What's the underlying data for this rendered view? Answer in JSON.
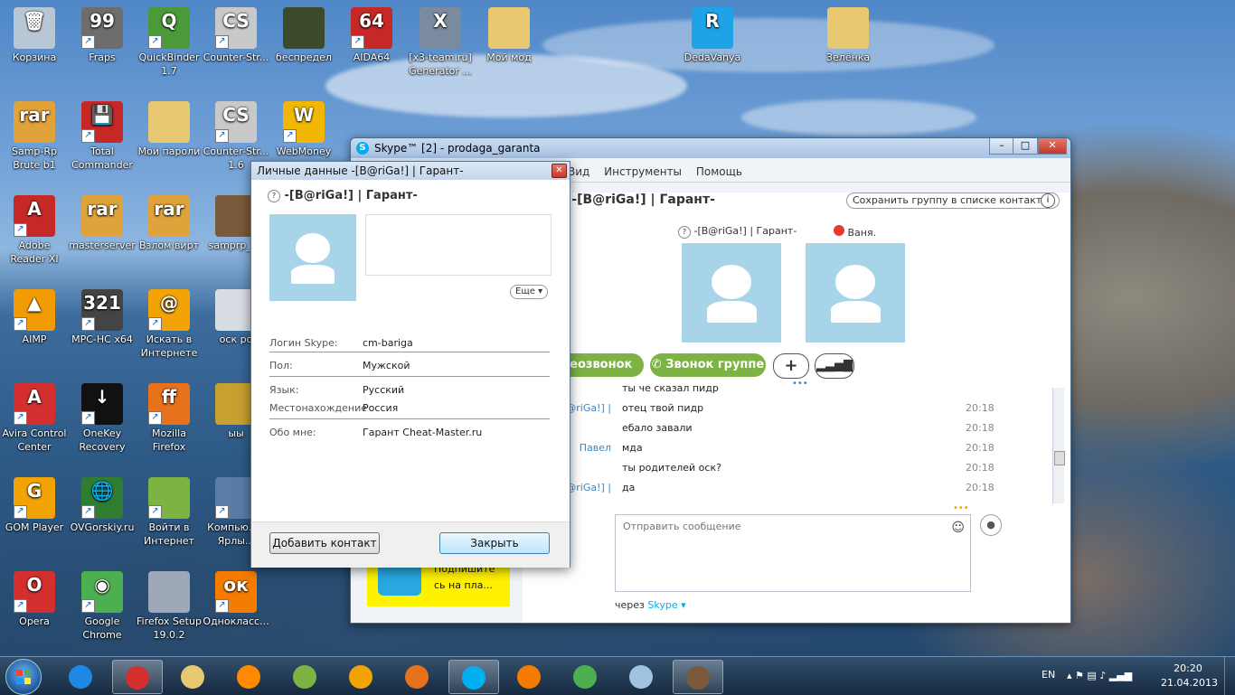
{
  "desktop": {
    "icons": [
      {
        "id": "recycle",
        "label": "Корзина",
        "col": 0,
        "row": 0,
        "color": "#b7c7d6",
        "glyph": "🗑",
        "shortcut": false
      },
      {
        "id": "fraps",
        "label": "Fraps",
        "col": 1,
        "row": 0,
        "color": "#6d6d6d",
        "glyph": "99",
        "shortcut": true
      },
      {
        "id": "quickbinder",
        "label": "QuickBinder 1.7",
        "col": 2,
        "row": 0,
        "color": "#4a9a3a",
        "glyph": "Q",
        "shortcut": true
      },
      {
        "id": "cs1",
        "label": "Counter-Str...",
        "col": 3,
        "row": 0,
        "color": "#c9c9c9",
        "glyph": "CS",
        "shortcut": true
      },
      {
        "id": "bespredel",
        "label": "беспредел",
        "col": 4,
        "row": 0,
        "color": "#3b4a2a",
        "glyph": "",
        "shortcut": false
      },
      {
        "id": "aida64",
        "label": "AIDA64",
        "col": 5,
        "row": 0,
        "color": "#c62828",
        "glyph": "64",
        "shortcut": true
      },
      {
        "id": "x3team",
        "label": "[x3-team.ru] Generator ...",
        "col": 6,
        "row": 0,
        "color": "#7a8ba0",
        "glyph": "X",
        "shortcut": false
      },
      {
        "id": "mymod",
        "label": "Мой мод",
        "col": 7,
        "row": 0,
        "color": "#e8c870",
        "glyph": "",
        "shortcut": false
      },
      {
        "id": "dedavanya",
        "label": "DedaVanya",
        "col": 10,
        "row": 0,
        "color": "#1fa3e8",
        "glyph": "R",
        "shortcut": false
      },
      {
        "id": "zelenka",
        "label": "Зелёнка",
        "col": 12,
        "row": 0,
        "color": "#e8c870",
        "glyph": "",
        "shortcut": false
      },
      {
        "id": "samprp",
        "label": "Samp-Rp Brute b1",
        "col": 0,
        "row": 1,
        "color": "#e0a23a",
        "glyph": "rar",
        "shortcut": false
      },
      {
        "id": "totalcmd",
        "label": "Total Commander",
        "col": 1,
        "row": 1,
        "color": "#c62828",
        "glyph": "💾",
        "shortcut": true
      },
      {
        "id": "passwords",
        "label": "Мои пароли",
        "col": 2,
        "row": 1,
        "color": "#e8c870",
        "glyph": "",
        "shortcut": false
      },
      {
        "id": "cs2",
        "label": "Counter-Str... 1.6",
        "col": 3,
        "row": 1,
        "color": "#c9c9c9",
        "glyph": "CS",
        "shortcut": true
      },
      {
        "id": "webmoney",
        "label": "WebMoney",
        "col": 4,
        "row": 1,
        "color": "#f2b705",
        "glyph": "W",
        "shortcut": true
      },
      {
        "id": "adobe",
        "label": "Adobe Reader XI",
        "col": 0,
        "row": 2,
        "color": "#c62828",
        "glyph": "A",
        "shortcut": true
      },
      {
        "id": "masterserver",
        "label": "masterserver",
        "col": 1,
        "row": 2,
        "color": "#e0a23a",
        "glyph": "rar",
        "shortcut": false
      },
      {
        "id": "vzlom",
        "label": "Взлом вирт",
        "col": 2,
        "row": 2,
        "color": "#e0a23a",
        "glyph": "rar",
        "shortcut": false
      },
      {
        "id": "samprpf",
        "label": "samprp_f...",
        "col": 3,
        "row": 2,
        "color": "#7a5a3a",
        "glyph": "",
        "shortcut": false
      },
      {
        "id": "aimp",
        "label": "AIMP",
        "col": 0,
        "row": 3,
        "color": "#f29b05",
        "glyph": "▲",
        "shortcut": true
      },
      {
        "id": "mpchc",
        "label": "MPC-HC x64",
        "col": 1,
        "row": 3,
        "color": "#444",
        "glyph": "321",
        "shortcut": true
      },
      {
        "id": "search",
        "label": "Искать в Интернете",
        "col": 2,
        "row": 3,
        "color": "#f2a305",
        "glyph": "@",
        "shortcut": true
      },
      {
        "id": "osk",
        "label": "оск ро",
        "col": 3,
        "row": 3,
        "color": "#d8dde4",
        "glyph": "",
        "shortcut": false
      },
      {
        "id": "avira",
        "label": "Avira Control Center",
        "col": 0,
        "row": 4,
        "color": "#d32f2f",
        "glyph": "A",
        "shortcut": true
      },
      {
        "id": "onekey",
        "label": "OneKey Recovery",
        "col": 1,
        "row": 4,
        "color": "#111",
        "glyph": "↓",
        "shortcut": true
      },
      {
        "id": "firefox",
        "label": "Mozilla Firefox",
        "col": 2,
        "row": 4,
        "color": "#e8711c",
        "glyph": "ff",
        "shortcut": true
      },
      {
        "id": "yy",
        "label": "ыы",
        "col": 3,
        "row": 4,
        "color": "#c8a030",
        "glyph": "",
        "shortcut": false
      },
      {
        "id": "gom",
        "label": "GOM Player",
        "col": 0,
        "row": 5,
        "color": "#f2a305",
        "glyph": "G",
        "shortcut": true
      },
      {
        "id": "ovgorskiy",
        "label": "OVGorskiy.ru",
        "col": 1,
        "row": 5,
        "color": "#2f7d32",
        "glyph": "🌐",
        "shortcut": true
      },
      {
        "id": "internet",
        "label": "Войти в Интернет",
        "col": 2,
        "row": 5,
        "color": "#7cb342",
        "glyph": "",
        "shortcut": true
      },
      {
        "id": "computer",
        "label": "Компью... - Ярлы...",
        "col": 3,
        "row": 5,
        "color": "#5a7da8",
        "glyph": "",
        "shortcut": true
      },
      {
        "id": "opera",
        "label": "Opera",
        "col": 0,
        "row": 6,
        "color": "#d32f2f",
        "glyph": "O",
        "shortcut": true
      },
      {
        "id": "chrome",
        "label": "Google Chrome",
        "col": 1,
        "row": 6,
        "color": "#4caf50",
        "glyph": "◉",
        "shortcut": true
      },
      {
        "id": "ffsetup",
        "label": "Firefox Setup 19.0.2",
        "col": 2,
        "row": 6,
        "color": "#9fa8b8",
        "glyph": "",
        "shortcut": false
      },
      {
        "id": "odnoklass",
        "label": "Однокласс...",
        "col": 3,
        "row": 6,
        "color": "#f57c00",
        "glyph": "ок",
        "shortcut": true
      }
    ]
  },
  "skype_window": {
    "title": "Skype™ [2] - prodaga_garanta",
    "menu": [
      "Вид",
      "Инструменты",
      "Помощь"
    ],
    "conversation_title": "Ваня., -[B@riGa!] | Гарант-",
    "save_group_label": "Сохранить группу в списке контактов",
    "participants": [
      {
        "name": "-[B@riGa!] | Гарант-",
        "status": "?"
      },
      {
        "name": "Ваня.",
        "status": "busy"
      }
    ],
    "buttons": {
      "video": "Видеозвонок",
      "group_call": "Звонок группе",
      "add": "+",
      "signal": "signal"
    },
    "messages": [
      {
        "sender": "",
        "text": "ты че сказал пидр",
        "time": ""
      },
      {
        "sender": "-[B@riGa!] |",
        "text": "отец твой пидр",
        "time": "20:18"
      },
      {
        "sender": "",
        "text": "ебало завали",
        "time": "20:18"
      },
      {
        "sender": "Павел",
        "text": "мда",
        "time": "20:18"
      },
      {
        "sender": "",
        "text": "ты родителей оск?",
        "time": "20:18"
      },
      {
        "sender": "-[B@riGa!] |",
        "text": "да",
        "time": "20:18"
      }
    ],
    "input_placeholder": "Отправить сообщение",
    "via_label": "через",
    "via_link": "Skype",
    "ad_text_1": "Подпишите",
    "ad_text_2": "сь на пла..."
  },
  "profile_dialog": {
    "title": "Личные данные -[B@riGa!] | Гарант-",
    "name": "-[B@riGa!] | Гарант-",
    "more_label": "Еще",
    "fields": [
      {
        "key": "Логин Skype:",
        "value": "cm-bariga"
      },
      {
        "key": "Пол:",
        "value": "Мужской"
      },
      {
        "key": "Язык:",
        "value": "Русский"
      },
      {
        "key": "Местонахождение",
        "value": "Россия"
      },
      {
        "key": "Обо мне:",
        "value": "Гарант Cheat-Master.ru"
      }
    ],
    "add_contact_label": "Добавить контакт",
    "close_label": "Закрыть"
  },
  "taskbar": {
    "items": [
      {
        "id": "ie",
        "color": "#1e88e5",
        "active": false
      },
      {
        "id": "opera",
        "color": "#d32f2f",
        "active": true
      },
      {
        "id": "explorer",
        "color": "#e8c870",
        "active": false
      },
      {
        "id": "mediaplayer",
        "color": "#ff8a00",
        "active": false
      },
      {
        "id": "internet",
        "color": "#7cb342",
        "active": false
      },
      {
        "id": "search",
        "color": "#f2a305",
        "active": false
      },
      {
        "id": "firefox",
        "color": "#e8711c",
        "active": false
      },
      {
        "id": "skype",
        "color": "#00aff0",
        "active": true
      },
      {
        "id": "odnoklassniki",
        "color": "#f57c00",
        "active": false
      },
      {
        "id": "chrome",
        "color": "#4caf50",
        "active": false
      },
      {
        "id": "app-blue",
        "color": "#9fc3e0",
        "active": false
      },
      {
        "id": "samp",
        "color": "#7a5a3a",
        "active": true
      }
    ],
    "lang": "EN",
    "time": "20:20",
    "date": "21.04.2013"
  }
}
